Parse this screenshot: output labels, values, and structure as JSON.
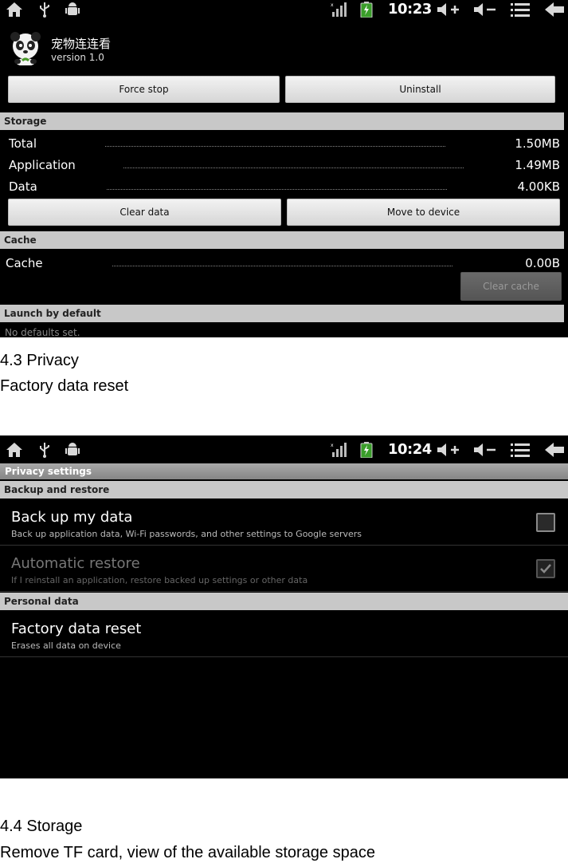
{
  "screenshot1": {
    "statusbar": {
      "time": "10:23"
    },
    "app": {
      "name": "宠物连连看",
      "version": "version 1.0"
    },
    "buttons": {
      "force_stop": "Force stop",
      "uninstall": "Uninstall",
      "clear_data": "Clear data",
      "move_to_device": "Move to device",
      "clear_cache": "Clear cache"
    },
    "storage": {
      "header": "Storage",
      "rows": [
        {
          "label": "Total",
          "value": "1.50MB"
        },
        {
          "label": "Application",
          "value": "1.49MB"
        },
        {
          "label": "Data",
          "value": "4.00KB"
        }
      ]
    },
    "cache": {
      "header": "Cache",
      "label": "Cache",
      "value": "0.00B"
    },
    "launch": {
      "header": "Launch by default",
      "text": "No defaults set."
    }
  },
  "doc": {
    "heading1": "4.3 Privacy",
    "line1": "Factory data reset",
    "heading2": "4.4 Storage",
    "line2": "Remove TF card, view of the available storage space"
  },
  "screenshot2": {
    "statusbar": {
      "time": "10:24"
    },
    "title": "Privacy settings",
    "backup_header": "Backup and restore",
    "items": [
      {
        "title": "Back up my data",
        "summary": "Back up application data, Wi-Fi passwords, and other settings to Google servers",
        "checked": false,
        "enabled": true
      },
      {
        "title": "Automatic restore",
        "summary": "If I reinstall an application, restore backed up settings or other data",
        "checked": true,
        "enabled": false
      }
    ],
    "personal_header": "Personal data",
    "factory": {
      "title": "Factory data reset",
      "summary": "Erases all data on device"
    }
  },
  "icons": [
    "home-icon",
    "usb-icon",
    "android-debug-icon",
    "signal-icon",
    "battery-charging-icon",
    "volume-up-icon",
    "volume-down-icon",
    "menu-icon",
    "back-icon"
  ]
}
